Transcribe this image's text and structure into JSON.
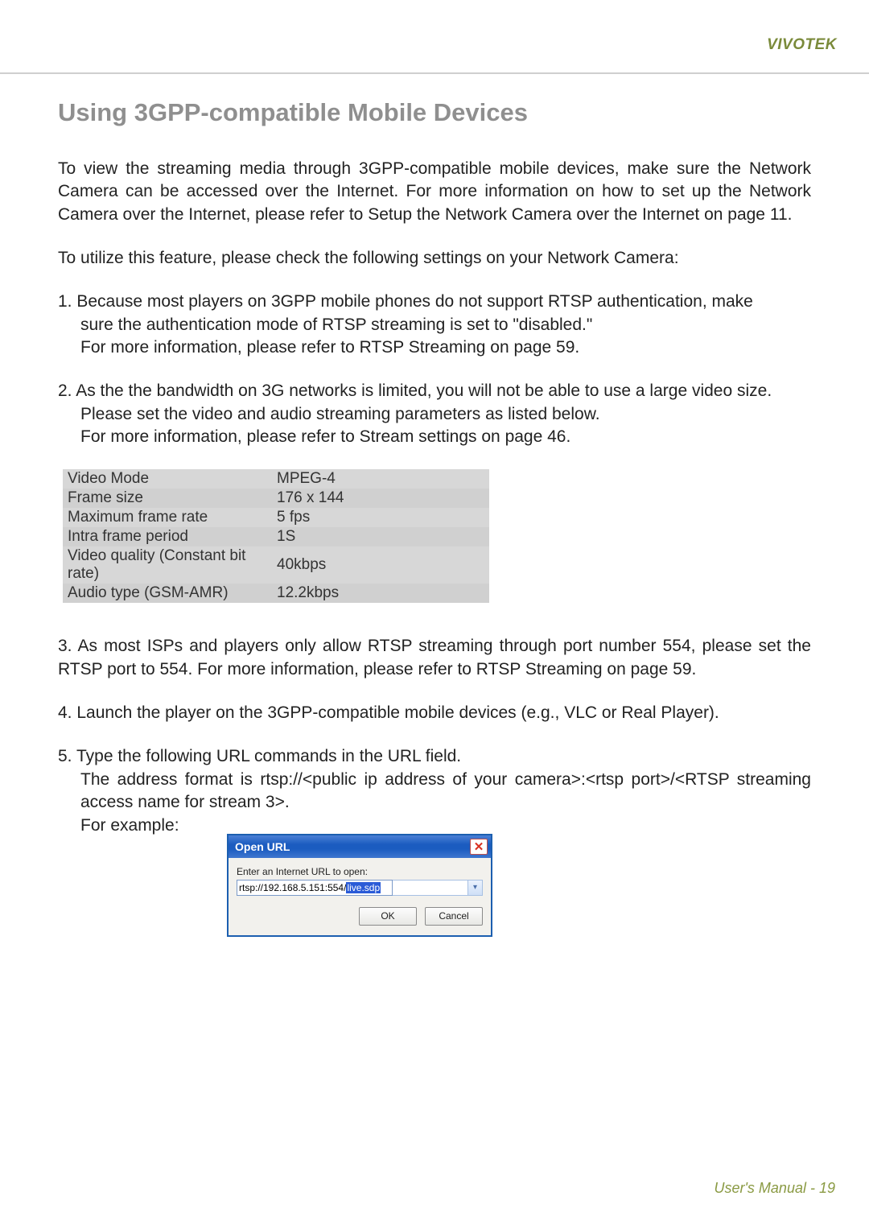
{
  "brand": "VIVOTEK",
  "section_title": "Using 3GPP-compatible Mobile Devices",
  "para_intro": "To view the streaming media through 3GPP-compatible mobile devices, make sure the Network Camera can be accessed over the Internet. For more information on how to set up the Network Camera over the Internet, please refer to Setup the Network Camera over the Internet on page 11.",
  "para_utilize": "To utilize this feature, please check the following settings on your Network Camera:",
  "item1_line1": "1. Because most players on 3GPP mobile phones do not support RTSP authentication, make",
  "item1_line2": "sure the authentication mode of RTSP streaming is set to \"disabled.\"",
  "item1_line3": "For more information, please refer to RTSP Streaming on page 59.",
  "item2_line1": "2. As the the bandwidth on 3G networks is limited, you will not be able to use a large video size.",
  "item2_line2": "Please set the video and audio streaming parameters as listed below.",
  "item2_line3": "For more information, please refer to Stream settings on page 46.",
  "settings_table": [
    {
      "label": "Video Mode",
      "value": "MPEG-4"
    },
    {
      "label": "Frame size",
      "value": "176 x 144"
    },
    {
      "label": "Maximum frame rate",
      "value": "5 fps"
    },
    {
      "label": "Intra frame period",
      "value": "1S"
    },
    {
      "label": "Video quality (Constant bit rate)",
      "value": "40kbps"
    },
    {
      "label": "Audio type (GSM-AMR)",
      "value": "12.2kbps"
    }
  ],
  "item3": "3. As most ISPs and players only allow RTSP streaming through port number 554, please set the RTSP port to 554. For more information, please refer to RTSP Streaming on page 59.",
  "item4": "4. Launch the player on the 3GPP-compatible mobile devices (e.g., VLC or Real Player).",
  "item5_line1": "5. Type the following URL commands in the URL field.",
  "item5_line2": "The address format is rtsp://<public ip address of your camera>:<rtsp port>/<RTSP streaming access name for stream 3>.",
  "item5_line3": "For example:",
  "dialog": {
    "title": "Open URL",
    "prompt": "Enter an Internet URL to open:",
    "url_plain": "rtsp://192.168.5.151:554/",
    "url_highlight": "live.sdp",
    "ok_label": "OK",
    "cancel_label": "Cancel"
  },
  "footer_label": "User's Manual - ",
  "footer_page": "19"
}
